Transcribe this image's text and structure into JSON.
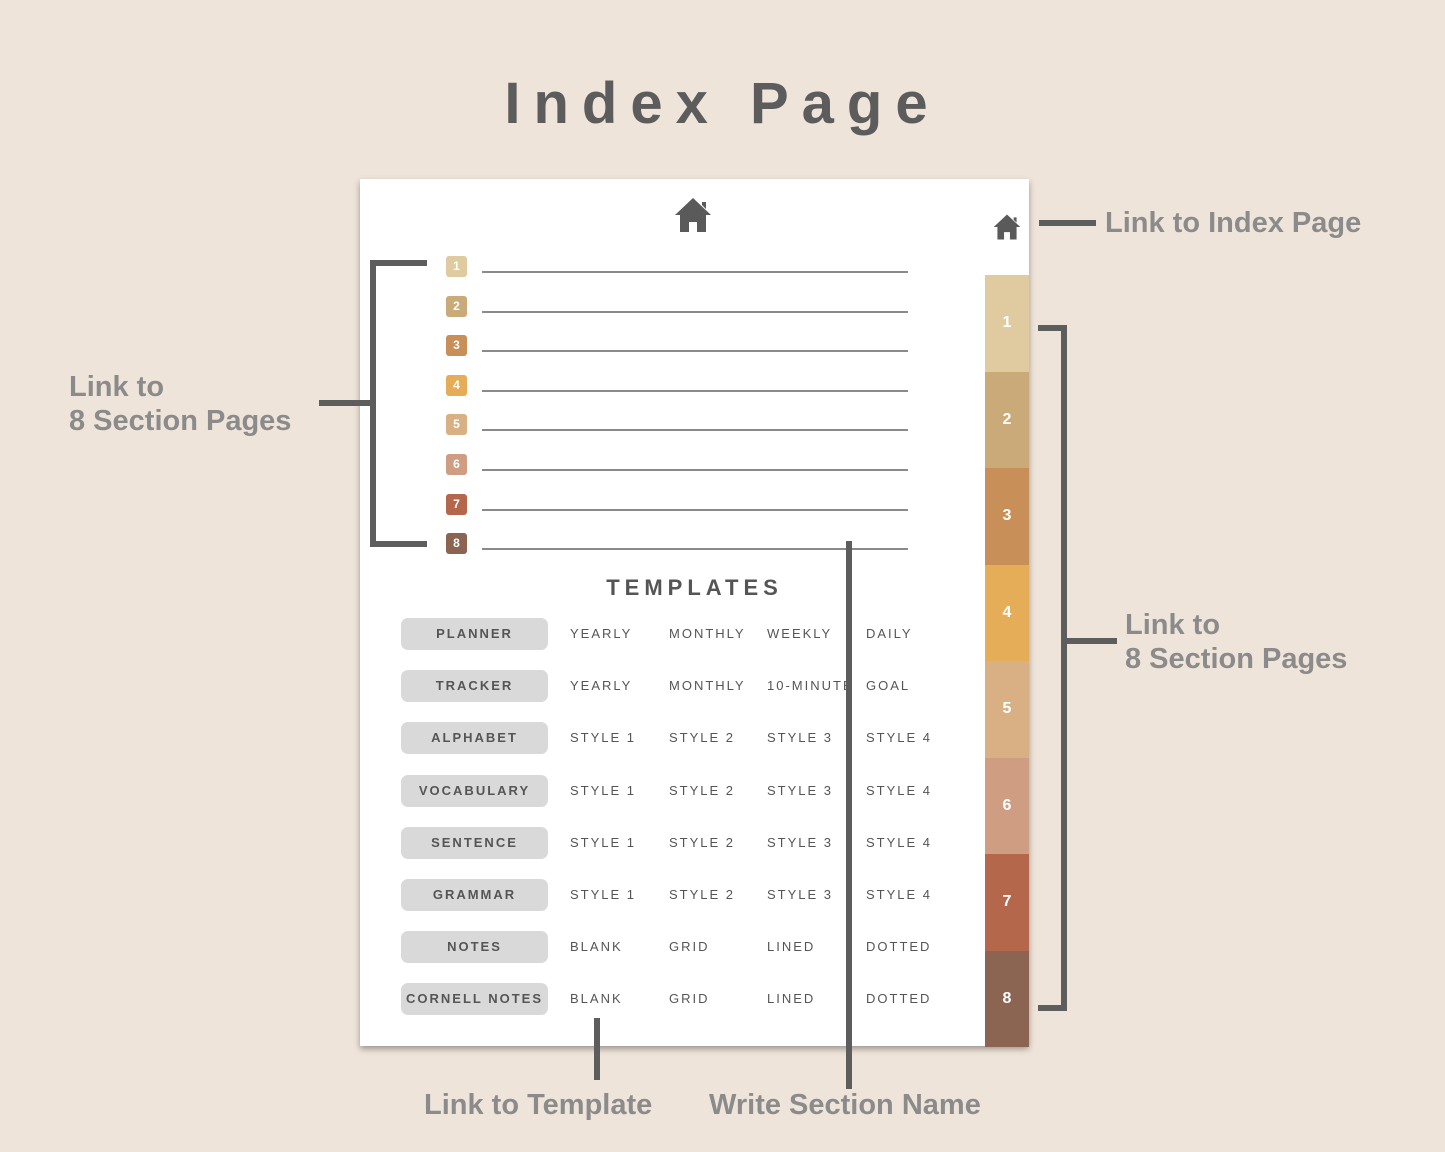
{
  "title": "Index Page",
  "page": {
    "home_icon": "home-icon",
    "sections": [
      {
        "number": "1",
        "color": "#dfcb9f"
      },
      {
        "number": "2",
        "color": "#c9aa78"
      },
      {
        "number": "3",
        "color": "#c98f58"
      },
      {
        "number": "4",
        "color": "#e6ad58"
      },
      {
        "number": "5",
        "color": "#d9b083"
      },
      {
        "number": "6",
        "color": "#cf9d82"
      },
      {
        "number": "7",
        "color": "#b4674b"
      },
      {
        "number": "8",
        "color": "#8c6452"
      }
    ],
    "templates_heading": "TEMPLATES",
    "templates": [
      {
        "category": "PLANNER",
        "options": [
          "YEARLY",
          "MONTHLY",
          "WEEKLY",
          "DAILY"
        ]
      },
      {
        "category": "TRACKER",
        "options": [
          "YEARLY",
          "MONTHLY",
          "10-MINUTE",
          "GOAL"
        ]
      },
      {
        "category": "ALPHABET",
        "options": [
          "STYLE 1",
          "STYLE 2",
          "STYLE 3",
          "STYLE 4"
        ]
      },
      {
        "category": "VOCABULARY",
        "options": [
          "STYLE 1",
          "STYLE 2",
          "STYLE 3",
          "STYLE 4"
        ]
      },
      {
        "category": "SENTENCE",
        "options": [
          "STYLE 1",
          "STYLE 2",
          "STYLE 3",
          "STYLE 4"
        ]
      },
      {
        "category": "GRAMMAR",
        "options": [
          "STYLE 1",
          "STYLE 2",
          "STYLE 3",
          "STYLE 4"
        ]
      },
      {
        "category": "NOTES",
        "options": [
          "BLANK",
          "GRID",
          "LINED",
          "DOTTED"
        ]
      },
      {
        "category": "CORNELL NOTES",
        "options": [
          "BLANK",
          "GRID",
          "LINED",
          "DOTTED"
        ]
      }
    ]
  },
  "annotations": {
    "index_link": "Link to Index Page",
    "sections_left_line1": "Link to",
    "sections_left_line2": "8 Section Pages",
    "sections_right_line1": "Link to",
    "sections_right_line2": "8 Section Pages",
    "template_link": "Link to Template",
    "section_name": "Write Section Name"
  },
  "colors": {
    "background": "#efe4da",
    "annotation_text": "#8b8b8b",
    "title_text": "#5c5c5c",
    "bracket": "#5d5d5d"
  }
}
